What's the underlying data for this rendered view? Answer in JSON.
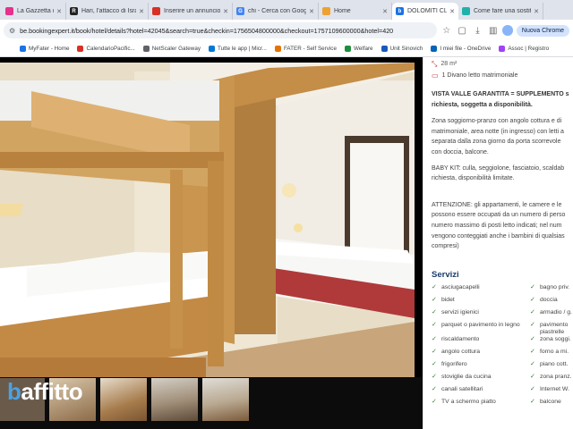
{
  "browser": {
    "tabs": [
      {
        "label": "La Gazzetta dello Sport",
        "fav_color": "#e8308d",
        "fav_letter": "",
        "active": false
      },
      {
        "label": "Hari, l'attacco di Israele",
        "fav_color": "#222222",
        "fav_letter": "R",
        "active": false
      },
      {
        "label": "Inserire un annuncio",
        "fav_color": "#d93025",
        "fav_letter": "",
        "active": false
      },
      {
        "label": "chi - Cerca con Google",
        "fav_color": "#4285f4",
        "fav_letter": "G",
        "active": false
      },
      {
        "label": "Home",
        "fav_color": "#f0a030",
        "fav_letter": "",
        "active": false
      },
      {
        "label": "DOLOMITI CLUB",
        "fav_color": "#1a73e8",
        "fav_letter": "b",
        "active": true
      },
      {
        "label": "Come fare una sostituzione",
        "fav_color": "#20b2aa",
        "fav_letter": "",
        "active": false
      }
    ],
    "url": "be.bookingexpert.it/book/hotel/details?hotel=42045&search=true&checkin=1756504800000&checkout=1757109600000&hotel=420",
    "profile_label": "Nuova Chrome"
  },
  "bookmarks": [
    {
      "label": "MyFater - Home",
      "color": "#1a73e8"
    },
    {
      "label": "CalendarioPacific...",
      "color": "#d93025"
    },
    {
      "label": "NetScaler Gateway",
      "color": "#5f6368"
    },
    {
      "label": "Tutte le app | Micr...",
      "color": "#0078d4"
    },
    {
      "label": "FATER - Self Service",
      "color": "#e37400"
    },
    {
      "label": "Welfare",
      "color": "#1e8e3e"
    },
    {
      "label": "Unit Sinovich",
      "color": "#185abc"
    },
    {
      "label": "I miei file - OneDrive",
      "color": "#0364b8"
    },
    {
      "label": "Assoc | Registro",
      "color": "#a142f4"
    }
  ],
  "gallery": {
    "logo_prefix": "b",
    "logo_text": "affitto"
  },
  "details": {
    "size": "28 m²",
    "bed": "1 Divano letto matrimoniale",
    "para1": [
      "VISTA VALLE GARANTITA = SUPPLEMENTO s",
      "richiesta, soggetta a disponibilità."
    ],
    "para2": [
      "Zona soggiorno-pranzo con angolo cottura e di",
      "matrimoniale, area notte (in ingresso) con letti a",
      "separata dalla zona giorno da porta scorrevole",
      "con doccia, balcone."
    ],
    "para3": [
      "BABY KIT: culla, seggiolone, fasciatoio, scaldab",
      "richiesta, disponibilità limitate."
    ],
    "para4": [
      "ATTENZIONE: gli appartamenti, le camere e le",
      "possono essere occupati da un numero di perso",
      "numero massimo di posti letto indicati; nel num",
      "vengono conteggiati anche i bambini di qualsias",
      "compresi)"
    ]
  },
  "services": {
    "title": "Servizi",
    "col1": [
      "asciugacapelli",
      "bidet",
      "servizi igienici",
      "parquet o pavimento in legno",
      "riscaldamento",
      "angolo cottura",
      "frigorifero",
      "stoviglie da cucina",
      "canali satellitari",
      "TV a schermo piatto"
    ],
    "col2": [
      "bagno priv.",
      "doccia",
      "armadio / g.",
      "pavimento piastrelle",
      "zona soggi.",
      "forno a mi.",
      "piano cott.",
      "zona pranz.",
      "Internet W.",
      "balcone"
    ]
  }
}
